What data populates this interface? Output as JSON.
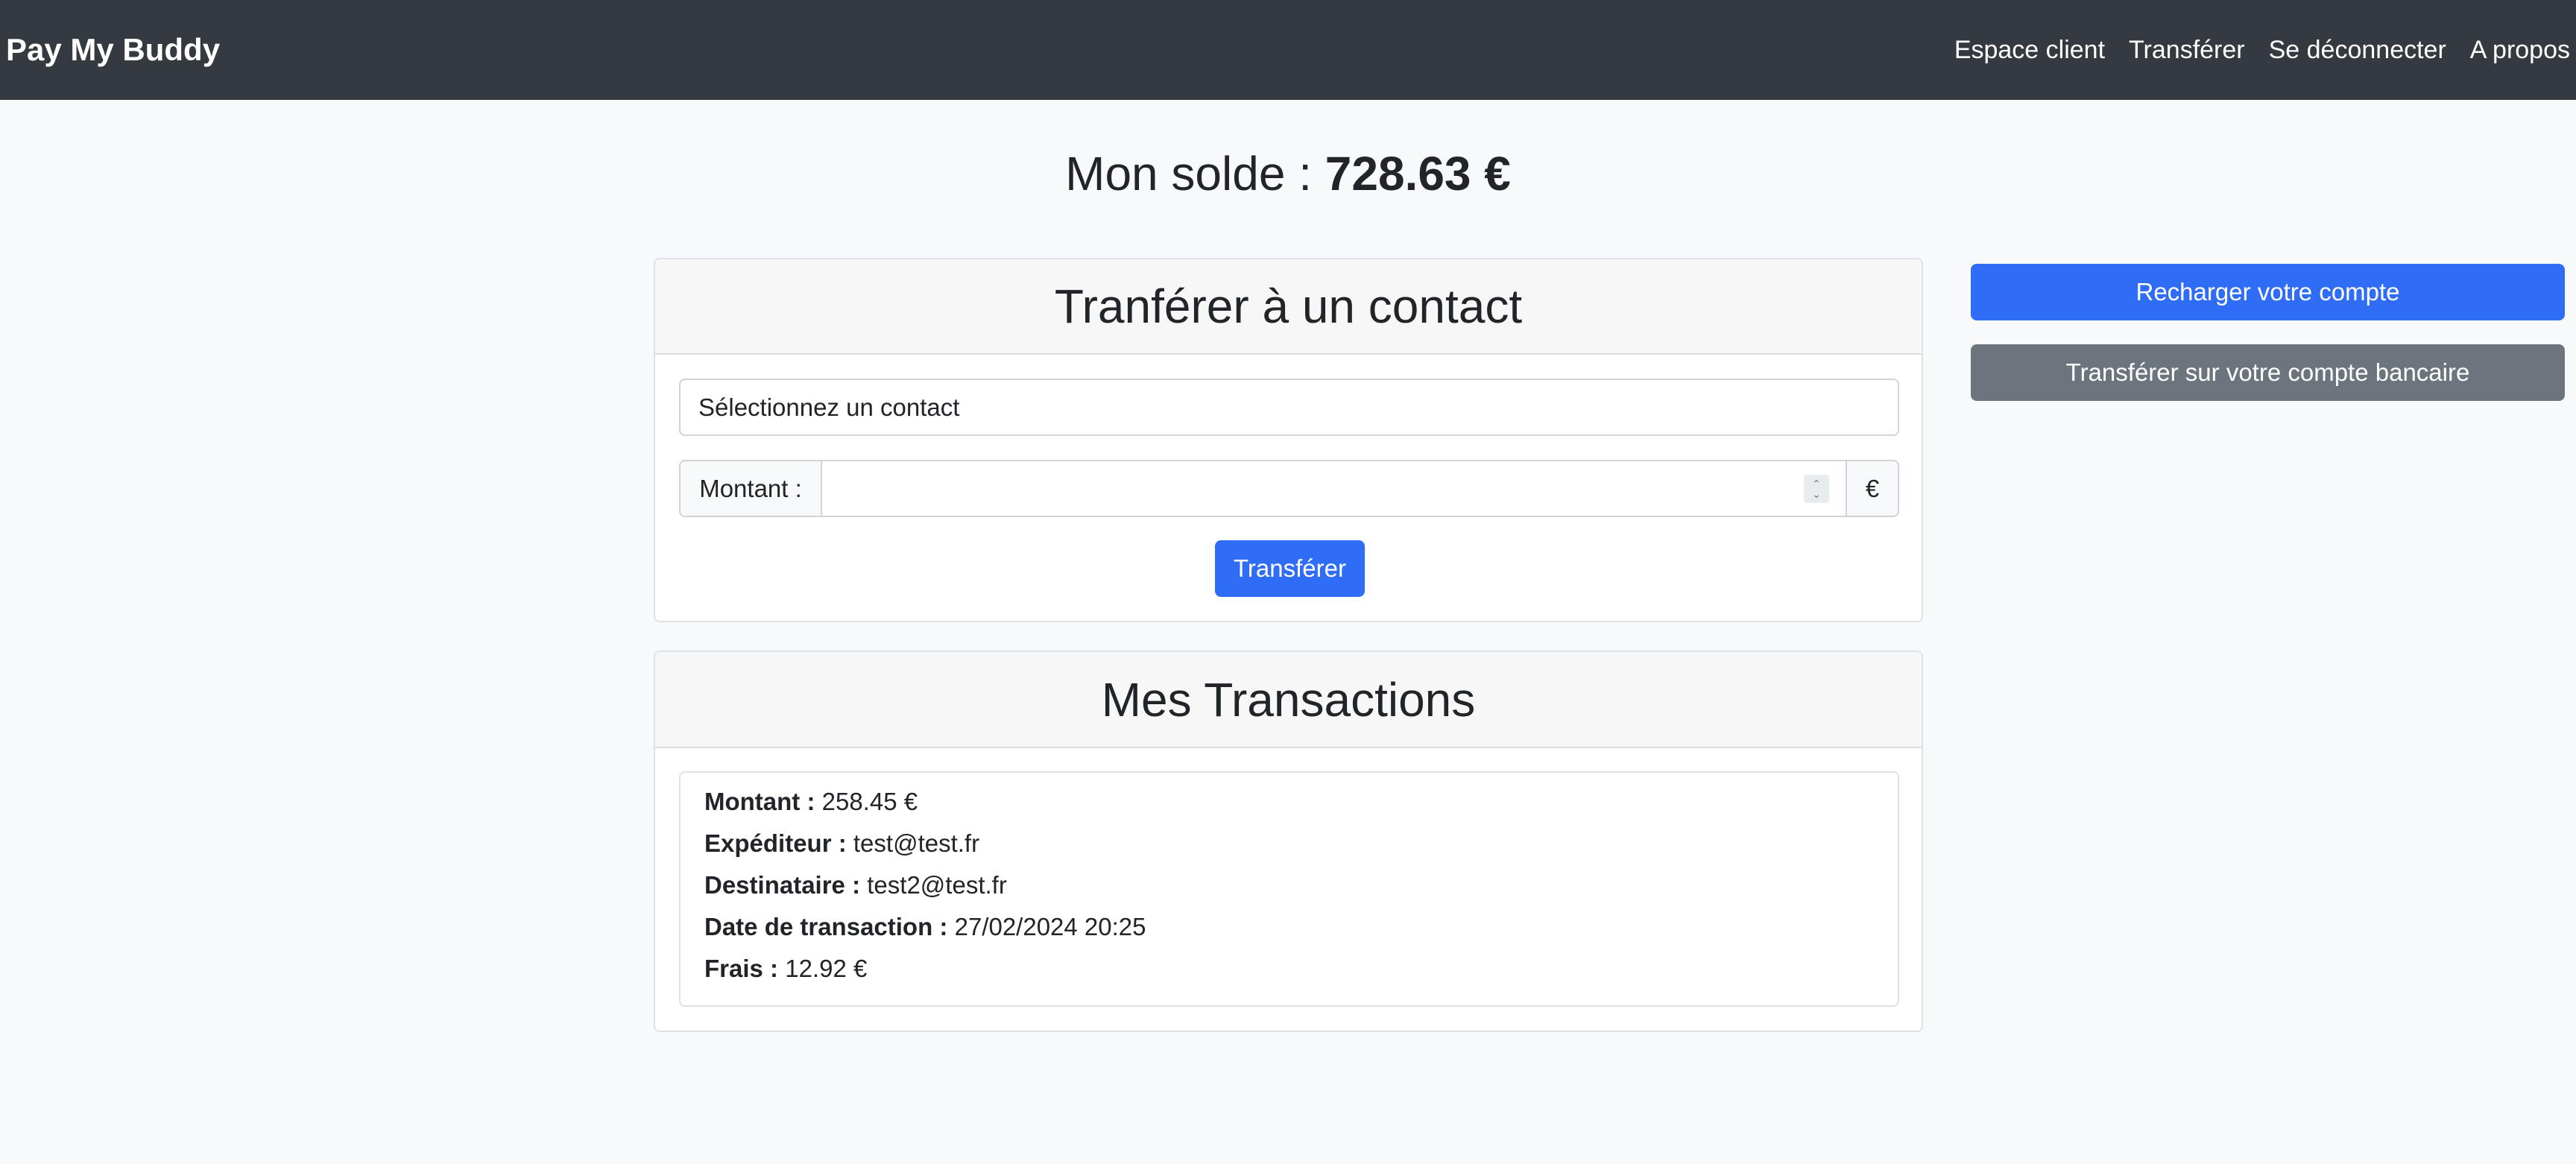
{
  "navbar": {
    "brand": "Pay My Buddy",
    "links": [
      "Espace client",
      "Transférer",
      "Se déconnecter",
      "A propos"
    ]
  },
  "balance": {
    "label": "Mon solde : ",
    "amount": "728.63 €"
  },
  "transfer": {
    "title": "Tranférer à un contact",
    "select_value": "Sélectionnez un contact",
    "amount_label": "Montant :",
    "amount_value": "",
    "currency": "€",
    "submit_label": "Transférer"
  },
  "transactions": {
    "title": "Mes Transactions",
    "items": [
      {
        "amount_key": "Montant :",
        "amount": "258.45 €",
        "sender_key": "Expéditeur :",
        "sender": "test@test.fr",
        "recipient_key": "Destinataire :",
        "recipient": "test2@test.fr",
        "date_key": "Date de transaction :",
        "date": "27/02/2024 20:25",
        "fees_key": "Frais :",
        "fees": "12.92 €"
      }
    ]
  },
  "sidebar": {
    "recharge_label": "Recharger votre compte",
    "bank_transfer_label": "Transférer sur votre compte bancaire"
  },
  "colors": {
    "navbar": "#343a40",
    "primary": "#2f6df6",
    "secondary": "#6c757d"
  }
}
